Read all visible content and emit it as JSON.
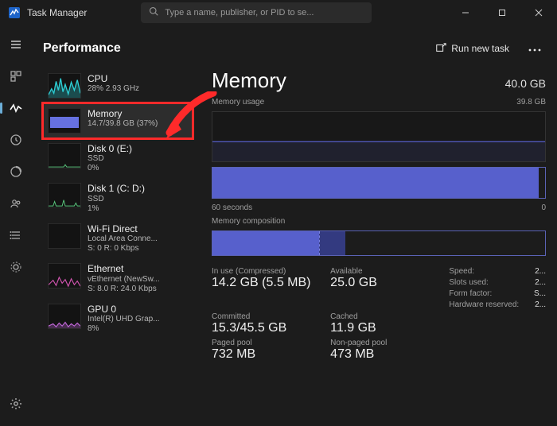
{
  "titlebar": {
    "app_title": "Task Manager",
    "search_placeholder": "Type a name, publisher, or PID to se..."
  },
  "page": {
    "title": "Performance",
    "run_new_task": "Run new task"
  },
  "sidebar": {
    "items": [
      {
        "label": "CPU",
        "sub1": "28%  2.93 GHz",
        "sub2": ""
      },
      {
        "label": "Memory",
        "sub1": "14.7/39.8 GB (37%)",
        "sub2": ""
      },
      {
        "label": "Disk 0 (E:)",
        "sub1": "SSD",
        "sub2": "0%"
      },
      {
        "label": "Disk 1 (C: D:)",
        "sub1": "SSD",
        "sub2": "1%"
      },
      {
        "label": "Wi-Fi Direct",
        "sub1": "Local Area Conne...",
        "sub2": "S: 0 R: 0 Kbps"
      },
      {
        "label": "Ethernet",
        "sub1": "vEthernet (NewSw...",
        "sub2": "S: 8.0 R: 24.0 Kbps"
      },
      {
        "label": "GPU 0",
        "sub1": "Intel(R) UHD Grap...",
        "sub2": "8%"
      }
    ]
  },
  "main": {
    "title": "Memory",
    "total": "40.0 GB",
    "usage_label": "Memory usage",
    "usage_right": "39.8 GB",
    "timeline_left": "60 seconds",
    "timeline_right": "0",
    "composition_label": "Memory composition",
    "stats": {
      "in_use_label": "In use (Compressed)",
      "in_use_value": "14.2 GB (5.5 MB)",
      "available_label": "Available",
      "available_value": "25.0 GB",
      "committed_label": "Committed",
      "committed_value": "15.3/45.5 GB",
      "cached_label": "Cached",
      "cached_value": "11.9 GB",
      "paged_label": "Paged pool",
      "paged_value": "732 MB",
      "nonpaged_label": "Non-paged pool",
      "nonpaged_value": "473 MB"
    },
    "details": {
      "speed_label": "Speed:",
      "speed_value": "2...",
      "slots_label": "Slots used:",
      "slots_value": "2...",
      "form_label": "Form factor:",
      "form_value": "S...",
      "hw_label": "Hardware reserved:",
      "hw_value": "2..."
    }
  }
}
